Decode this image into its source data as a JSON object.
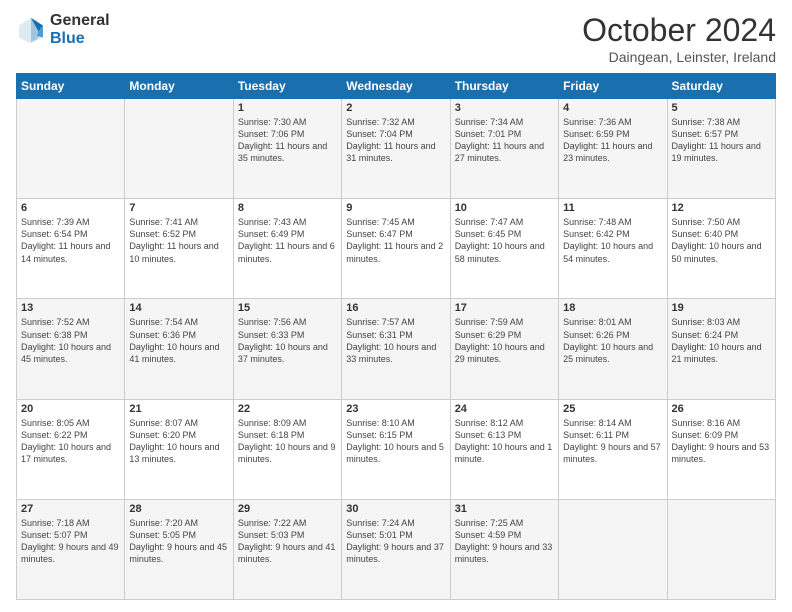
{
  "logo": {
    "general": "General",
    "blue": "Blue"
  },
  "title": "October 2024",
  "subtitle": "Daingean, Leinster, Ireland",
  "headers": [
    "Sunday",
    "Monday",
    "Tuesday",
    "Wednesday",
    "Thursday",
    "Friday",
    "Saturday"
  ],
  "weeks": [
    [
      {
        "day": "",
        "content": ""
      },
      {
        "day": "",
        "content": ""
      },
      {
        "day": "1",
        "content": "Sunrise: 7:30 AM\nSunset: 7:06 PM\nDaylight: 11 hours and 35 minutes."
      },
      {
        "day": "2",
        "content": "Sunrise: 7:32 AM\nSunset: 7:04 PM\nDaylight: 11 hours and 31 minutes."
      },
      {
        "day": "3",
        "content": "Sunrise: 7:34 AM\nSunset: 7:01 PM\nDaylight: 11 hours and 27 minutes."
      },
      {
        "day": "4",
        "content": "Sunrise: 7:36 AM\nSunset: 6:59 PM\nDaylight: 11 hours and 23 minutes."
      },
      {
        "day": "5",
        "content": "Sunrise: 7:38 AM\nSunset: 6:57 PM\nDaylight: 11 hours and 19 minutes."
      }
    ],
    [
      {
        "day": "6",
        "content": "Sunrise: 7:39 AM\nSunset: 6:54 PM\nDaylight: 11 hours and 14 minutes."
      },
      {
        "day": "7",
        "content": "Sunrise: 7:41 AM\nSunset: 6:52 PM\nDaylight: 11 hours and 10 minutes."
      },
      {
        "day": "8",
        "content": "Sunrise: 7:43 AM\nSunset: 6:49 PM\nDaylight: 11 hours and 6 minutes."
      },
      {
        "day": "9",
        "content": "Sunrise: 7:45 AM\nSunset: 6:47 PM\nDaylight: 11 hours and 2 minutes."
      },
      {
        "day": "10",
        "content": "Sunrise: 7:47 AM\nSunset: 6:45 PM\nDaylight: 10 hours and 58 minutes."
      },
      {
        "day": "11",
        "content": "Sunrise: 7:48 AM\nSunset: 6:42 PM\nDaylight: 10 hours and 54 minutes."
      },
      {
        "day": "12",
        "content": "Sunrise: 7:50 AM\nSunset: 6:40 PM\nDaylight: 10 hours and 50 minutes."
      }
    ],
    [
      {
        "day": "13",
        "content": "Sunrise: 7:52 AM\nSunset: 6:38 PM\nDaylight: 10 hours and 45 minutes."
      },
      {
        "day": "14",
        "content": "Sunrise: 7:54 AM\nSunset: 6:36 PM\nDaylight: 10 hours and 41 minutes."
      },
      {
        "day": "15",
        "content": "Sunrise: 7:56 AM\nSunset: 6:33 PM\nDaylight: 10 hours and 37 minutes."
      },
      {
        "day": "16",
        "content": "Sunrise: 7:57 AM\nSunset: 6:31 PM\nDaylight: 10 hours and 33 minutes."
      },
      {
        "day": "17",
        "content": "Sunrise: 7:59 AM\nSunset: 6:29 PM\nDaylight: 10 hours and 29 minutes."
      },
      {
        "day": "18",
        "content": "Sunrise: 8:01 AM\nSunset: 6:26 PM\nDaylight: 10 hours and 25 minutes."
      },
      {
        "day": "19",
        "content": "Sunrise: 8:03 AM\nSunset: 6:24 PM\nDaylight: 10 hours and 21 minutes."
      }
    ],
    [
      {
        "day": "20",
        "content": "Sunrise: 8:05 AM\nSunset: 6:22 PM\nDaylight: 10 hours and 17 minutes."
      },
      {
        "day": "21",
        "content": "Sunrise: 8:07 AM\nSunset: 6:20 PM\nDaylight: 10 hours and 13 minutes."
      },
      {
        "day": "22",
        "content": "Sunrise: 8:09 AM\nSunset: 6:18 PM\nDaylight: 10 hours and 9 minutes."
      },
      {
        "day": "23",
        "content": "Sunrise: 8:10 AM\nSunset: 6:15 PM\nDaylight: 10 hours and 5 minutes."
      },
      {
        "day": "24",
        "content": "Sunrise: 8:12 AM\nSunset: 6:13 PM\nDaylight: 10 hours and 1 minute."
      },
      {
        "day": "25",
        "content": "Sunrise: 8:14 AM\nSunset: 6:11 PM\nDaylight: 9 hours and 57 minutes."
      },
      {
        "day": "26",
        "content": "Sunrise: 8:16 AM\nSunset: 6:09 PM\nDaylight: 9 hours and 53 minutes."
      }
    ],
    [
      {
        "day": "27",
        "content": "Sunrise: 7:18 AM\nSunset: 5:07 PM\nDaylight: 9 hours and 49 minutes."
      },
      {
        "day": "28",
        "content": "Sunrise: 7:20 AM\nSunset: 5:05 PM\nDaylight: 9 hours and 45 minutes."
      },
      {
        "day": "29",
        "content": "Sunrise: 7:22 AM\nSunset: 5:03 PM\nDaylight: 9 hours and 41 minutes."
      },
      {
        "day": "30",
        "content": "Sunrise: 7:24 AM\nSunset: 5:01 PM\nDaylight: 9 hours and 37 minutes."
      },
      {
        "day": "31",
        "content": "Sunrise: 7:25 AM\nSunset: 4:59 PM\nDaylight: 9 hours and 33 minutes."
      },
      {
        "day": "",
        "content": ""
      },
      {
        "day": "",
        "content": ""
      }
    ]
  ]
}
